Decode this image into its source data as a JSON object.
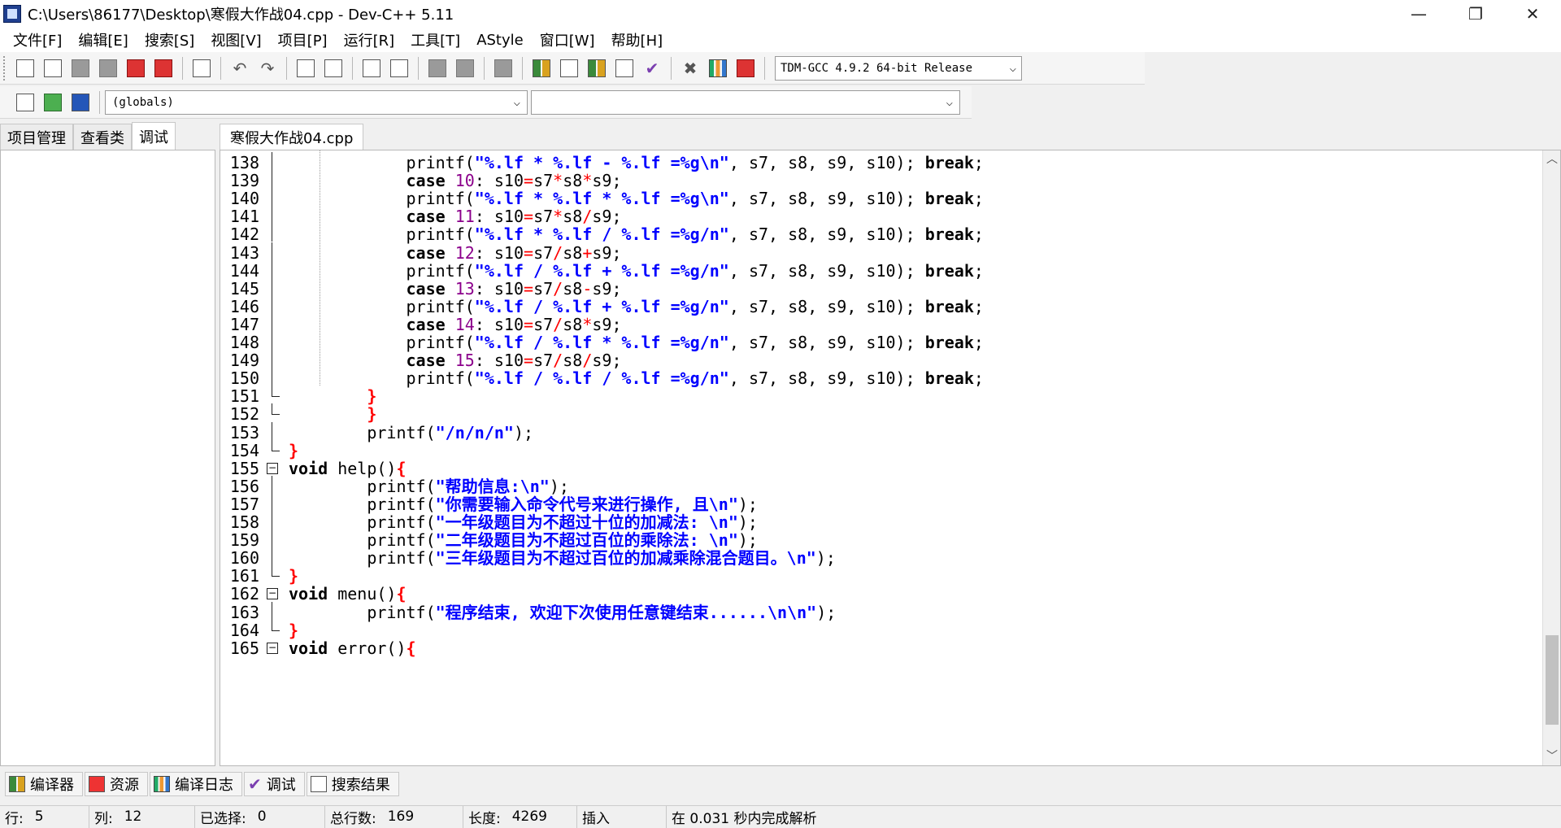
{
  "window": {
    "title": "C:\\Users\\86177\\Desktop\\寒假大作战04.cpp - Dev-C++ 5.11",
    "controls": {
      "minimize": "—",
      "restore": "❐",
      "close": "✕"
    }
  },
  "menu": [
    "文件[F]",
    "编辑[E]",
    "搜索[S]",
    "视图[V]",
    "项目[P]",
    "运行[R]",
    "工具[T]",
    "AStyle",
    "窗口[W]",
    "帮助[H]"
  ],
  "toolbar": {
    "compiler": "TDM-GCC 4.9.2 64-bit Release",
    "scope": "(globals)",
    "member": ""
  },
  "left_tabs": [
    "项目管理",
    "查看类",
    "调试"
  ],
  "editor_tab": "寒假大作战04.cpp",
  "code_lines": [
    {
      "n": "138",
      "t": [
        [
          "id",
          "            printf("
        ],
        [
          "str",
          "\"%.lf * %.lf - %.lf =%g\\n\""
        ],
        [
          "id",
          ", s7, s8, s9, s10); "
        ],
        [
          "kw",
          "break"
        ],
        [
          "id",
          ";"
        ]
      ]
    },
    {
      "n": "139",
      "t": [
        [
          "id",
          "            "
        ],
        [
          "kw",
          "case"
        ],
        [
          "id",
          " "
        ],
        [
          "num",
          "10"
        ],
        [
          "id",
          ": s10"
        ],
        [
          "op",
          "="
        ],
        [
          "id",
          "s7"
        ],
        [
          "op",
          "*"
        ],
        [
          "id",
          "s8"
        ],
        [
          "op",
          "*"
        ],
        [
          "id",
          "s9;"
        ]
      ]
    },
    {
      "n": "140",
      "t": [
        [
          "id",
          "            printf("
        ],
        [
          "str",
          "\"%.lf * %.lf * %.lf =%g\\n\""
        ],
        [
          "id",
          ", s7, s8, s9, s10); "
        ],
        [
          "kw",
          "break"
        ],
        [
          "id",
          ";"
        ]
      ]
    },
    {
      "n": "141",
      "t": [
        [
          "id",
          "            "
        ],
        [
          "kw",
          "case"
        ],
        [
          "id",
          " "
        ],
        [
          "num",
          "11"
        ],
        [
          "id",
          ": s10"
        ],
        [
          "op",
          "="
        ],
        [
          "id",
          "s7"
        ],
        [
          "op",
          "*"
        ],
        [
          "id",
          "s8"
        ],
        [
          "op",
          "/"
        ],
        [
          "id",
          "s9;"
        ]
      ]
    },
    {
      "n": "142",
      "t": [
        [
          "id",
          "            printf("
        ],
        [
          "str",
          "\"%.lf * %.lf / %.lf =%g/n\""
        ],
        [
          "id",
          ", s7, s8, s9, s10); "
        ],
        [
          "kw",
          "break"
        ],
        [
          "id",
          ";"
        ]
      ]
    },
    {
      "n": "143",
      "t": [
        [
          "id",
          "            "
        ],
        [
          "kw",
          "case"
        ],
        [
          "id",
          " "
        ],
        [
          "num",
          "12"
        ],
        [
          "id",
          ": s10"
        ],
        [
          "op",
          "="
        ],
        [
          "id",
          "s7"
        ],
        [
          "op",
          "/"
        ],
        [
          "id",
          "s8"
        ],
        [
          "op",
          "+"
        ],
        [
          "id",
          "s9;"
        ]
      ]
    },
    {
      "n": "144",
      "t": [
        [
          "id",
          "            printf("
        ],
        [
          "str",
          "\"%.lf / %.lf + %.lf =%g/n\""
        ],
        [
          "id",
          ", s7, s8, s9, s10); "
        ],
        [
          "kw",
          "break"
        ],
        [
          "id",
          ";"
        ]
      ]
    },
    {
      "n": "145",
      "t": [
        [
          "id",
          "            "
        ],
        [
          "kw",
          "case"
        ],
        [
          "id",
          " "
        ],
        [
          "num",
          "13"
        ],
        [
          "id",
          ": s10"
        ],
        [
          "op",
          "="
        ],
        [
          "id",
          "s7"
        ],
        [
          "op",
          "/"
        ],
        [
          "id",
          "s8"
        ],
        [
          "op",
          "-"
        ],
        [
          "id",
          "s9;"
        ]
      ]
    },
    {
      "n": "146",
      "t": [
        [
          "id",
          "            printf("
        ],
        [
          "str",
          "\"%.lf / %.lf + %.lf =%g/n\""
        ],
        [
          "id",
          ", s7, s8, s9, s10); "
        ],
        [
          "kw",
          "break"
        ],
        [
          "id",
          ";"
        ]
      ]
    },
    {
      "n": "147",
      "t": [
        [
          "id",
          "            "
        ],
        [
          "kw",
          "case"
        ],
        [
          "id",
          " "
        ],
        [
          "num",
          "14"
        ],
        [
          "id",
          ": s10"
        ],
        [
          "op",
          "="
        ],
        [
          "id",
          "s7"
        ],
        [
          "op",
          "/"
        ],
        [
          "id",
          "s8"
        ],
        [
          "op",
          "*"
        ],
        [
          "id",
          "s9;"
        ]
      ]
    },
    {
      "n": "148",
      "t": [
        [
          "id",
          "            printf("
        ],
        [
          "str",
          "\"%.lf / %.lf * %.lf =%g/n\""
        ],
        [
          "id",
          ", s7, s8, s9, s10); "
        ],
        [
          "kw",
          "break"
        ],
        [
          "id",
          ";"
        ]
      ]
    },
    {
      "n": "149",
      "t": [
        [
          "id",
          "            "
        ],
        [
          "kw",
          "case"
        ],
        [
          "id",
          " "
        ],
        [
          "num",
          "15"
        ],
        [
          "id",
          ": s10"
        ],
        [
          "op",
          "="
        ],
        [
          "id",
          "s7"
        ],
        [
          "op",
          "/"
        ],
        [
          "id",
          "s8"
        ],
        [
          "op",
          "/"
        ],
        [
          "id",
          "s9;"
        ]
      ]
    },
    {
      "n": "150",
      "t": [
        [
          "id",
          "            printf("
        ],
        [
          "str",
          "\"%.lf / %.lf / %.lf =%g/n\""
        ],
        [
          "id",
          ", s7, s8, s9, s10); "
        ],
        [
          "kw",
          "break"
        ],
        [
          "id",
          ";"
        ]
      ]
    },
    {
      "n": "151",
      "t": [
        [
          "id",
          "        "
        ],
        [
          "br",
          "}"
        ]
      ]
    },
    {
      "n": "152",
      "t": [
        [
          "id",
          "        "
        ],
        [
          "br",
          "}"
        ]
      ]
    },
    {
      "n": "153",
      "t": [
        [
          "id",
          "        printf("
        ],
        [
          "str",
          "\"/n/n/n\""
        ],
        [
          "id",
          ");"
        ]
      ]
    },
    {
      "n": "154",
      "t": [
        [
          "br",
          "}"
        ]
      ]
    },
    {
      "n": "155",
      "t": [
        [
          "kw",
          "void"
        ],
        [
          "id",
          " help()"
        ],
        [
          "br",
          "{"
        ]
      ]
    },
    {
      "n": "156",
      "t": [
        [
          "id",
          "        printf("
        ],
        [
          "str",
          "\"帮助信息:\\n\""
        ],
        [
          "id",
          ");"
        ]
      ]
    },
    {
      "n": "157",
      "t": [
        [
          "id",
          "        printf("
        ],
        [
          "str",
          "\"你需要输入命令代号来进行操作, 且\\n\""
        ],
        [
          "id",
          ");"
        ]
      ]
    },
    {
      "n": "158",
      "t": [
        [
          "id",
          "        printf("
        ],
        [
          "str",
          "\"一年级题目为不超过十位的加减法: \\n\""
        ],
        [
          "id",
          ");"
        ]
      ]
    },
    {
      "n": "159",
      "t": [
        [
          "id",
          "        printf("
        ],
        [
          "str",
          "\"二年级题目为不超过百位的乘除法: \\n\""
        ],
        [
          "id",
          ");"
        ]
      ]
    },
    {
      "n": "160",
      "t": [
        [
          "id",
          "        printf("
        ],
        [
          "str",
          "\"三年级题目为不超过百位的加减乘除混合题目。\\n\""
        ],
        [
          "id",
          ");"
        ]
      ]
    },
    {
      "n": "161",
      "t": [
        [
          "br",
          "}"
        ]
      ]
    },
    {
      "n": "162",
      "t": [
        [
          "kw",
          "void"
        ],
        [
          "id",
          " menu()"
        ],
        [
          "br",
          "{"
        ]
      ]
    },
    {
      "n": "163",
      "t": [
        [
          "id",
          "        printf("
        ],
        [
          "str",
          "\"程序结束, 欢迎下次使用任意键结束......\\n\\n\""
        ],
        [
          "id",
          ");"
        ]
      ]
    },
    {
      "n": "164",
      "t": [
        [
          "br",
          "}"
        ]
      ]
    },
    {
      "n": "165",
      "t": [
        [
          "kw",
          "void"
        ],
        [
          "id",
          " error()"
        ],
        [
          "br",
          "{"
        ]
      ]
    }
  ],
  "bottom_tabs": [
    "编译器",
    "资源",
    "编译日志",
    "调试",
    "搜索结果"
  ],
  "status": {
    "row_label": "行:",
    "row": "5",
    "col_label": "列:",
    "col": "12",
    "sel_label": "已选择:",
    "sel": "0",
    "total_label": "总行数:",
    "total": "169",
    "len_label": "长度:",
    "len": "4269",
    "mode": "插入",
    "parse": "在 0.031 秒内完成解析"
  },
  "colors": {
    "keyword": "#000000",
    "string": "#0000ff",
    "number": "#8b008b",
    "operator": "#ff0000"
  }
}
